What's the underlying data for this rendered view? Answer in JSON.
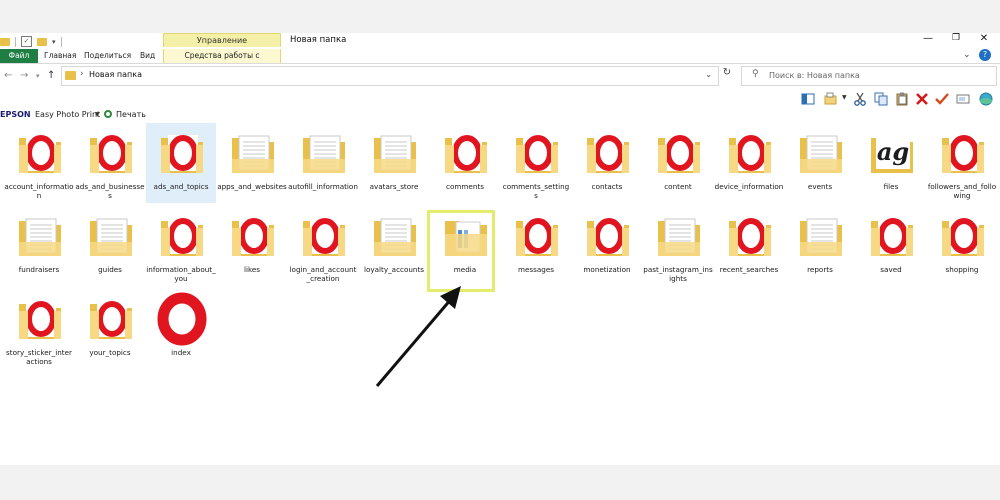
{
  "window": {
    "title": "Новая папка",
    "context_group": "Управление"
  },
  "ribbon": {
    "tabs": [
      {
        "label": "Файл"
      },
      {
        "label": "Главная"
      },
      {
        "label": "Поделиться"
      },
      {
        "label": "Вид"
      }
    ],
    "context_tab": "Средства работы с рисунками"
  },
  "address": {
    "path": "Новая папка",
    "search_placeholder": "Поиск в: Новая папка"
  },
  "toolbar": {
    "brand": "EPSON",
    "app": "Easy Photo Print",
    "print_label": "Печать"
  },
  "colors": {
    "accent_file_tab": "#1f7e44",
    "folder_yellow": "#f4d27a",
    "opera_red": "#e0151f",
    "highlight": "#e4ec6c",
    "selection": "#e0eef9"
  },
  "items": [
    {
      "label": "account_information",
      "icon": "opera-folder-icon"
    },
    {
      "label": "ads_and_businesses",
      "icon": "opera-folder-icon"
    },
    {
      "label": "ads_and_topics",
      "icon": "opera-folder-icon",
      "selected": true
    },
    {
      "label": "apps_and_websites",
      "icon": "document-folder-icon"
    },
    {
      "label": "autofill_information",
      "icon": "document-folder-icon"
    },
    {
      "label": "avatars_store",
      "icon": "document-folder-icon"
    },
    {
      "label": "comments",
      "icon": "opera-folder-icon"
    },
    {
      "label": "comments_settings",
      "icon": "opera-folder-icon"
    },
    {
      "label": "contacts",
      "icon": "opera-folder-icon"
    },
    {
      "label": "content",
      "icon": "opera-folder-icon"
    },
    {
      "label": "device_information",
      "icon": "opera-folder-icon"
    },
    {
      "label": "events",
      "icon": "document-folder-icon"
    },
    {
      "label": "files",
      "icon": "ag-folder-icon"
    },
    {
      "label": "followers_and_following",
      "icon": "opera-folder-icon"
    },
    {
      "label": "fundraisers",
      "icon": "document-folder-icon"
    },
    {
      "label": "guides",
      "icon": "document-folder-icon"
    },
    {
      "label": "information_about_you",
      "icon": "opera-folder-icon"
    },
    {
      "label": "likes",
      "icon": "opera-folder-icon"
    },
    {
      "label": "login_and_account_creation",
      "icon": "opera-folder-icon"
    },
    {
      "label": "loyalty_accounts",
      "icon": "document-folder-icon"
    },
    {
      "label": "media",
      "icon": "media-folder-icon",
      "highlighted": true
    },
    {
      "label": "messages",
      "icon": "opera-folder-icon"
    },
    {
      "label": "monetization",
      "icon": "opera-folder-icon"
    },
    {
      "label": "past_instagram_insights",
      "icon": "document-folder-icon"
    },
    {
      "label": "recent_searches",
      "icon": "opera-folder-icon"
    },
    {
      "label": "reports",
      "icon": "document-folder-icon"
    },
    {
      "label": "saved",
      "icon": "opera-folder-icon"
    },
    {
      "label": "shopping",
      "icon": "opera-folder-icon"
    },
    {
      "label": "story_sticker_interactions",
      "icon": "opera-folder-icon"
    },
    {
      "label": "your_topics",
      "icon": "opera-folder-icon"
    },
    {
      "label": "index",
      "icon": "opera-logo-icon"
    }
  ]
}
